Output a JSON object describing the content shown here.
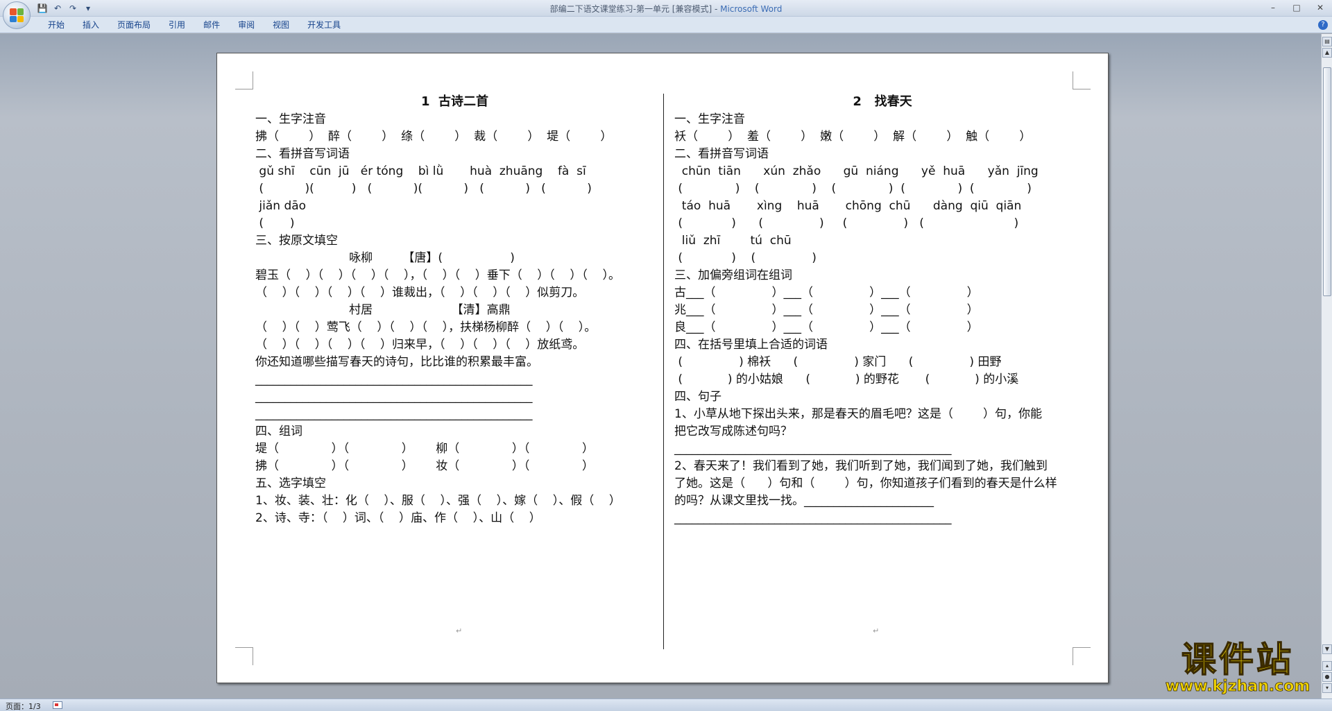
{
  "window": {
    "title": "部编二下语文课堂练习-第一单元 [兼容模式] - ",
    "app_name": "Microsoft Word"
  },
  "quick_access": [
    "save-icon",
    "undo-icon",
    "redo-icon",
    "customize-icon"
  ],
  "ribbon_tabs": [
    "开始",
    "插入",
    "页面布局",
    "引用",
    "邮件",
    "审阅",
    "视图",
    "开发工具"
  ],
  "left_column": {
    "lines": [
      "1  古诗二首",
      "一、生字注音",
      "拂（        ）  醉（        ）  绦（        ）  裁（        ）  堤（        ）",
      "二、看拼音写词语",
      " gǔ shī    cūn  jū   ér tóng    bì lǜ       huà  zhuāng    fà  sī",
      " (           )(          )   (           )(           )   (           )   (           )",
      " jiǎn dāo",
      " (       )",
      "三、按原文填空",
      "                         咏柳        【唐】(                  )",
      "碧玉（    ）（    ）（    ）（    ），（    ）（    ）垂下（    ）（    ）（    ）。",
      "（    ）（    ）（    ）（    ）谁裁出，（    ）（    ）（    ）似剪刀。",
      "                         村居                     【清】高鼎",
      "（    ）（    ）莺飞（    ）（    ）（    ），扶梯杨柳醉（    ）（    ）。",
      "（    ）（    ）（    ）（    ）归来早，（    ）（    ）（    ）放纸鸢。",
      "你还知道哪些描写春天的诗句，比比谁的积累最丰富。",
      "_______________________________________________",
      "_______________________________________________",
      "_______________________________________________",
      "四、组词",
      "堤（              ）（              ）      柳（              ）（              ）",
      "拂（              ）（              ）      妆（              ）（              ）",
      "五、选字填空",
      "1、妆、装、壮：化（    ）、服（    ）、强（    ）、嫁（    ）、假（    ）",
      "2、诗、寺：（    ）词、（    ）庙、作（    ）、山（    ）"
    ]
  },
  "right_column": {
    "lines": [
      "2   找春天",
      "一、生字注音",
      "袄（        ）  羞（        ）  嫩（        ）  解（        ）  触（        ）",
      "二、看拼音写词语",
      "  chūn  tiān      xún  zhǎo      gū  niáng      yě  huā      yǎn  jīng",
      " (              )    (              )    (              )  (              )  (              )",
      "  táo  huā       xìng    huā       chōng  chū      dàng  qiū  qiān",
      " (             )      (               )     (               )   (                        )",
      "  liǔ  zhī        tú  chū",
      " (             )    (               )",
      "三、加偏旁组词在组词",
      "古___（               ）___（               ）___（               ）",
      "兆___（               ）___（               ）___（               ）",
      "良___（               ）___（               ）___（               ）",
      "四、在括号里填上合适的词语",
      " (               ) 棉袄      (               ) 家门      (               ) 田野",
      " (            ) 的小姑娘      (            ) 的野花       (            ) 的小溪",
      "四、句子",
      "1、小草从地下探出头来，那是春天的眉毛吧？这是（        ）句，你能",
      "把它改写成陈述句吗？",
      "_______________________________________________",
      "2、春天来了！我们看到了她，我们听到了她，我们闻到了她，我们触到",
      "了她。这是（      ）句和（        ）句，你知道孩子们看到的春天是什么样",
      "的吗？从课文里找一找。______________________",
      "_______________________________________________"
    ]
  },
  "status": {
    "page_label": "页面：1/3"
  },
  "watermark": {
    "text": "课件站",
    "url": "www.kjzhan.com"
  }
}
